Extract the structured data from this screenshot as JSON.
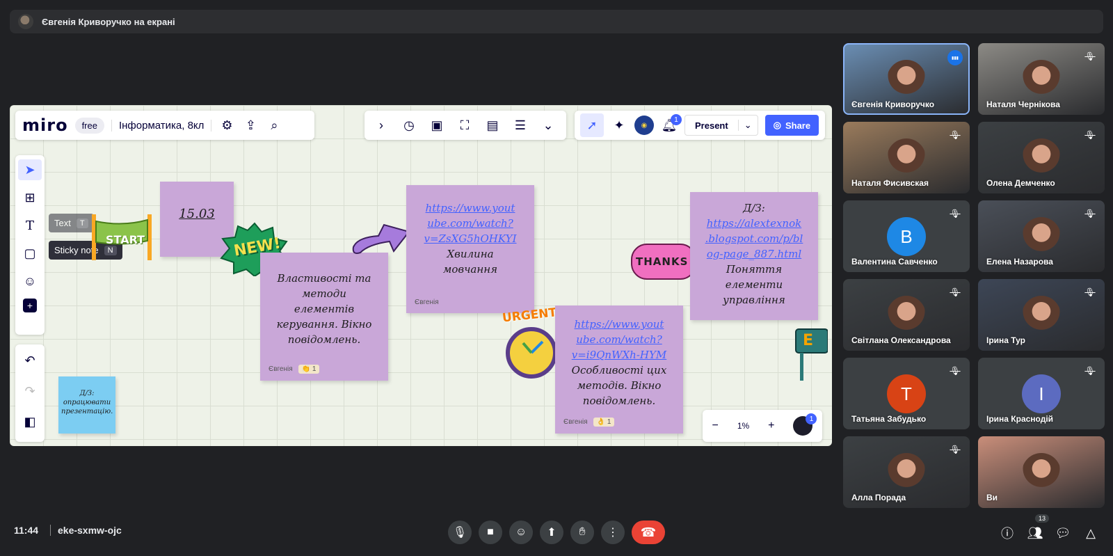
{
  "meet": {
    "presenting_banner": "Євгенія Криворучко на екрані",
    "time": "11:44",
    "meeting_code": "eke-sxmw-ojc",
    "participant_count": "13"
  },
  "miro": {
    "logo": "miro",
    "plan": "free",
    "board_name": "Інформатика, 8кл",
    "notifications": "1",
    "present_label": "Present",
    "share_label": "Share",
    "zoom_level": "1%",
    "avatar_badge": "1",
    "tooltip_text": {
      "label": "Text",
      "key": "T"
    },
    "tooltip_sticky": {
      "label": "Sticky note",
      "key": "N"
    }
  },
  "notes": {
    "date": "15.03",
    "note1": {
      "line1": "Властивості та",
      "line2": "методи",
      "line3": "елементів",
      "line4": "керування. Вікно",
      "line5": "повідомлень.",
      "author": "Євгенія",
      "reaction": "1"
    },
    "note2": {
      "link1": "https://www.yout",
      "link2": "ube.com/watch?",
      "link3": "v=ZsXG5hOHKYI",
      "line1": "Хвилина",
      "line2": "мовчання",
      "author": "Євгенія"
    },
    "note3": {
      "link1": "https://www.yout",
      "link2": "ube.com/watch?",
      "link3": "v=i9QnWXh-HYM",
      "line1": "Особливості цих",
      "line2": "методів. Вікно",
      "line3": "повідомлень.",
      "author": "Євгенія",
      "reaction": "1"
    },
    "note4": {
      "line0": "Д/З:",
      "link1": "https://alextexnok",
      "link2": ".blogspot.com/p/bl",
      "link3": "og-page_887.html",
      "line1": "Поняття",
      "line2": "елементи",
      "line3": "управління"
    },
    "note5": {
      "line1": "Д/З:",
      "line2": "опрацювати",
      "line3": "презентацію."
    }
  },
  "stickers": {
    "start": "START",
    "new": "NEW!",
    "thanks": "THANKS",
    "urgent": "URGENT!",
    "e": "E"
  },
  "participants": [
    {
      "name": "Євгенія Криворучко",
      "color": "#6b8fb5"
    },
    {
      "name": "Наталя Чернікова",
      "color": "#8c8a85"
    },
    {
      "name": "Наталя Фисивская",
      "color": "#9a7b5c"
    },
    {
      "name": "Олена Демченко",
      "color": "#3c4043"
    },
    {
      "name": "Валентина Савченко",
      "initial": "B",
      "color": "#1e88e5"
    },
    {
      "name": "Елена Назарова",
      "color": "#4a4f58"
    },
    {
      "name": "Світлана Олександрова",
      "color": "#3c4043"
    },
    {
      "name": "Ірина Тур",
      "color": "#3d4656"
    },
    {
      "name": "Татьяна Забудько",
      "initial": "T",
      "color": "#d84315"
    },
    {
      "name": "Ірина Краснодій",
      "initial": "I",
      "color": "#5c6bc0"
    },
    {
      "name": "Алла Порада",
      "color": "#3c4043"
    },
    {
      "name": "Ви",
      "color": "#c98e7a"
    }
  ]
}
